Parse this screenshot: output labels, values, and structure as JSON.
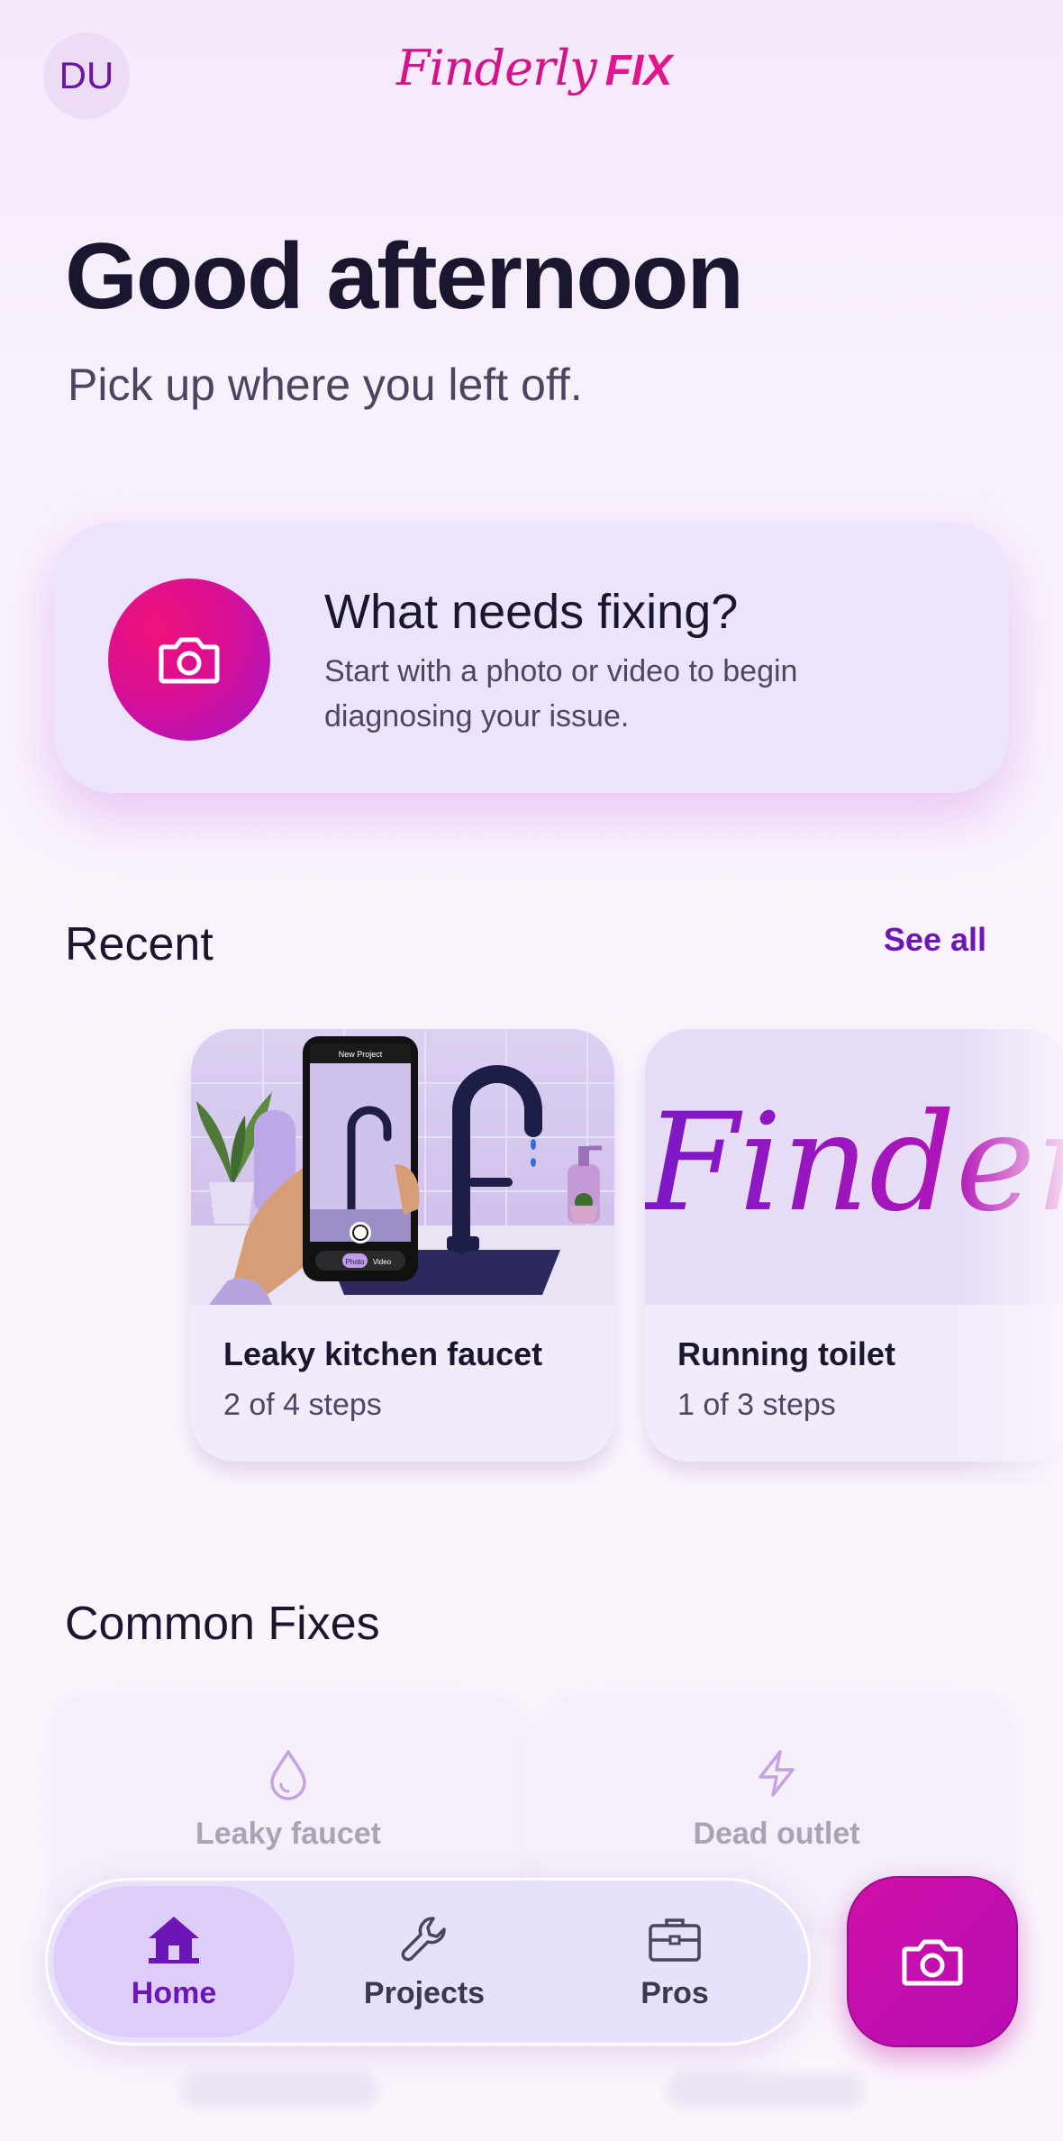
{
  "header": {
    "avatar_initials": "DU",
    "logo_script": "Finderly",
    "logo_fix": "FIX"
  },
  "greeting": {
    "title": "Good afternoon",
    "subtitle": "Pick up where you left off."
  },
  "fix_card": {
    "title": "What needs fixing?",
    "description": "Start with a photo or video to begin diagnosing your issue.",
    "icon": "camera-icon"
  },
  "recent": {
    "heading": "Recent",
    "see_all": "See all",
    "items": [
      {
        "title": "Leaky kitchen faucet",
        "steps": "2 of 4 steps",
        "image": "faucet-phone-photo",
        "phone_header": "New Project",
        "phone_modes": [
          "Photo",
          "Video"
        ]
      },
      {
        "title": "Running toilet",
        "steps": "1 of 3 steps",
        "image": "finderly-logo-thumbnail",
        "logo_text": "Finderly"
      }
    ]
  },
  "common_fixes": {
    "heading": "Common Fixes",
    "items": [
      {
        "label": "Leaky faucet",
        "icon": "droplet-icon"
      },
      {
        "label": "Dead outlet",
        "icon": "lightning-icon"
      }
    ]
  },
  "nav": {
    "items": [
      {
        "label": "Home",
        "icon": "home-icon",
        "active": true
      },
      {
        "label": "Projects",
        "icon": "wrench-icon",
        "active": false
      },
      {
        "label": "Pros",
        "icon": "briefcase-icon",
        "active": false
      }
    ],
    "fab_icon": "camera-icon"
  },
  "colors": {
    "accent": "#6d16b8",
    "brand_pink": "#e0168f",
    "card_bg": "#ebe4fb"
  }
}
